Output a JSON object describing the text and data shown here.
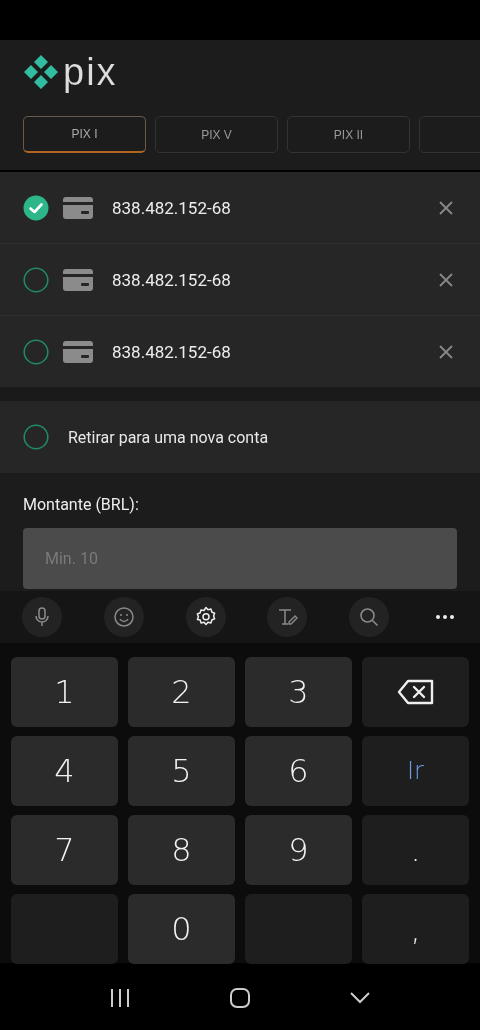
{
  "logo": {
    "text": "pix"
  },
  "tabs": [
    {
      "label": "PIX I",
      "selected": true
    },
    {
      "label": "PIX V",
      "selected": false
    },
    {
      "label": "PIX II",
      "selected": false
    },
    {
      "selected": false
    }
  ],
  "accounts": [
    {
      "number": "838.482.152-68",
      "selected": true
    },
    {
      "number": "838.482.152-68",
      "selected": false
    },
    {
      "number": "838.482.152-68",
      "selected": false
    }
  ],
  "new_account": {
    "label": "Retirar para uma nova conta",
    "selected": false
  },
  "amount": {
    "label": "Montante (BRL):",
    "placeholder": "Min. 10"
  },
  "keys": [
    {
      "kind": "char",
      "label": "1"
    },
    {
      "kind": "char",
      "label": "2"
    },
    {
      "kind": "char",
      "label": "3"
    },
    {
      "kind": "backspace"
    },
    {
      "kind": "char",
      "label": "4"
    },
    {
      "kind": "char",
      "label": "5"
    },
    {
      "kind": "char",
      "label": "6"
    },
    {
      "kind": "accent",
      "label": "Ir"
    },
    {
      "kind": "char",
      "label": "7"
    },
    {
      "kind": "char",
      "label": "8"
    },
    {
      "kind": "char",
      "label": "9"
    },
    {
      "kind": "dark",
      "label": "."
    },
    {
      "kind": "blank"
    },
    {
      "kind": "char",
      "label": "0"
    },
    {
      "kind": "blank"
    },
    {
      "kind": "dark",
      "label": ","
    }
  ]
}
